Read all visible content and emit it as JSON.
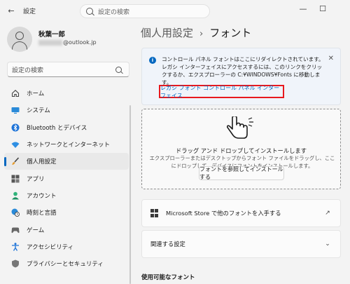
{
  "window": {
    "title": "設定",
    "search_placeholder": "設定の検索",
    "back_glyph": "←",
    "minimize_glyph": "—",
    "maximize_glyph": "☐"
  },
  "account": {
    "name": "秋葉一郎",
    "email_suffix": "@outlook.jp"
  },
  "sidebar": {
    "search_placeholder": "設定の検索",
    "items": [
      {
        "label": "ホーム",
        "icon": "home-icon"
      },
      {
        "label": "システム",
        "icon": "monitor-icon"
      },
      {
        "label": "Bluetooth とデバイス",
        "icon": "bluetooth-icon"
      },
      {
        "label": "ネットワークとインターネット",
        "icon": "wifi-icon"
      },
      {
        "label": "個人用設定",
        "icon": "brush-icon",
        "active": true
      },
      {
        "label": "アプリ",
        "icon": "apps-icon"
      },
      {
        "label": "アカウント",
        "icon": "person-icon"
      },
      {
        "label": "時刻と言語",
        "icon": "globe-clock-icon"
      },
      {
        "label": "ゲーム",
        "icon": "gamepad-icon"
      },
      {
        "label": "アクセシビリティ",
        "icon": "accessibility-icon"
      },
      {
        "label": "プライバシーとセキュリティ",
        "icon": "shield-icon"
      }
    ]
  },
  "main": {
    "breadcrumb_parent": "個人用設定",
    "breadcrumb_sep": "›",
    "breadcrumb_current": "フォント",
    "info": {
      "text": "コントロール パネル フォントはここにリダイレクトされています。レガシ インターフェイスにアクセスするには、このリンクをクリックするか、エクスプローラーの C:¥WINDOWS¥Fonts に移動します。",
      "link": "レガシ フォント コントロール パネル インターフェイス",
      "close_glyph": "✕"
    },
    "dropzone": {
      "title": "ドラッグ アンド ドロップしてインストールします",
      "subtitle": "エクスプローラーまたはデスクトップからフォント ファイルをドラッグし、ここにドロップして、デバイスにフォントをインストールします。",
      "button": "フォントを参照してインストールする"
    },
    "store_card": {
      "label": "Microsoft Store で他のフォントを入手する",
      "right_glyph": "↗"
    },
    "related_card": {
      "label": "関連する設定",
      "right_glyph": "⌄"
    },
    "section_available": "使用可能なフォント"
  },
  "colors": {
    "accent": "#0067c0",
    "highlight_border": "#e8191e"
  }
}
